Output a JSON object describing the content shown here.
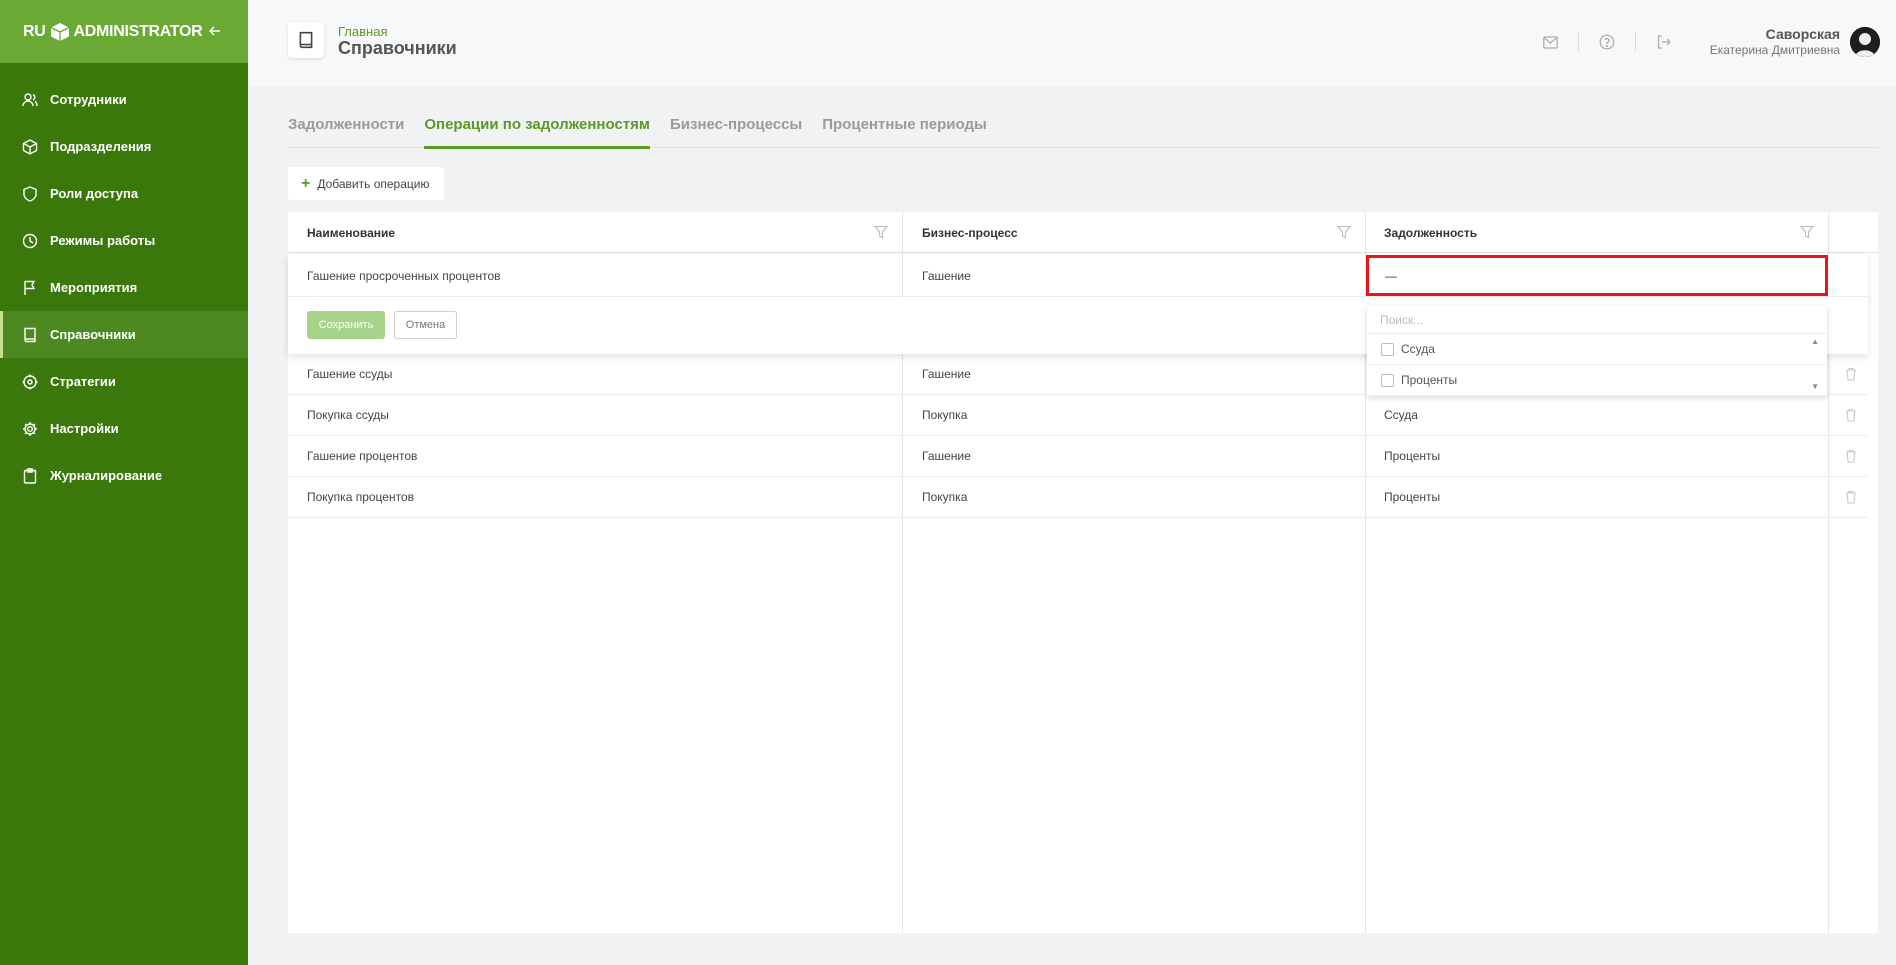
{
  "app": {
    "brand_left": "RU",
    "brand_right": "ADMINISTRATOR"
  },
  "sidebar": {
    "items": [
      {
        "label": "Сотрудники",
        "icon": "users-icon"
      },
      {
        "label": "Подразделения",
        "icon": "cube-icon"
      },
      {
        "label": "Роли доступа",
        "icon": "shield-icon"
      },
      {
        "label": "Режимы работы",
        "icon": "clock-icon"
      },
      {
        "label": "Мероприятия",
        "icon": "flag-icon"
      },
      {
        "label": "Справочники",
        "icon": "book-icon"
      },
      {
        "label": "Стратегии",
        "icon": "target-icon"
      },
      {
        "label": "Настройки",
        "icon": "gear-icon"
      },
      {
        "label": "Журналирование",
        "icon": "clipboard-icon"
      }
    ],
    "active_index": 5
  },
  "header": {
    "breadcrumb": "Главная",
    "title": "Справочники",
    "user_last_name": "Саворская",
    "user_first_name": "Екатерина Дмитриевна"
  },
  "tabs": [
    {
      "label": "Задолженности"
    },
    {
      "label": "Операции по задолженностям"
    },
    {
      "label": "Бизнес-процессы"
    },
    {
      "label": "Процентные периоды"
    }
  ],
  "active_tab": 1,
  "add_button": "Добавить операцию",
  "table": {
    "columns": [
      "Наименование",
      "Бизнес-процесс",
      "Задолженность"
    ],
    "editing_row": {
      "name": "Гашение просроченных процентов",
      "process": "Гашение",
      "debt": "—"
    },
    "rows": [
      {
        "name": "Гашение ссуды",
        "process": "Гашение",
        "debt": ""
      },
      {
        "name": "Покупка ссуды",
        "process": "Покупка",
        "debt": "Ссуда"
      },
      {
        "name": "Гашение процентов",
        "process": "Гашение",
        "debt": "Проценты"
      },
      {
        "name": "Покупка процентов",
        "process": "Покупка",
        "debt": "Проценты"
      }
    ]
  },
  "edit": {
    "save_label": "Сохранить",
    "cancel_label": "Отмена"
  },
  "dropdown": {
    "search_placeholder": "Поиск...",
    "options": [
      "Ссуда",
      "Проценты"
    ]
  },
  "colors": {
    "sidebar": "#3a780c",
    "accent": "#5a9a25",
    "highlight": "#e3151e"
  }
}
